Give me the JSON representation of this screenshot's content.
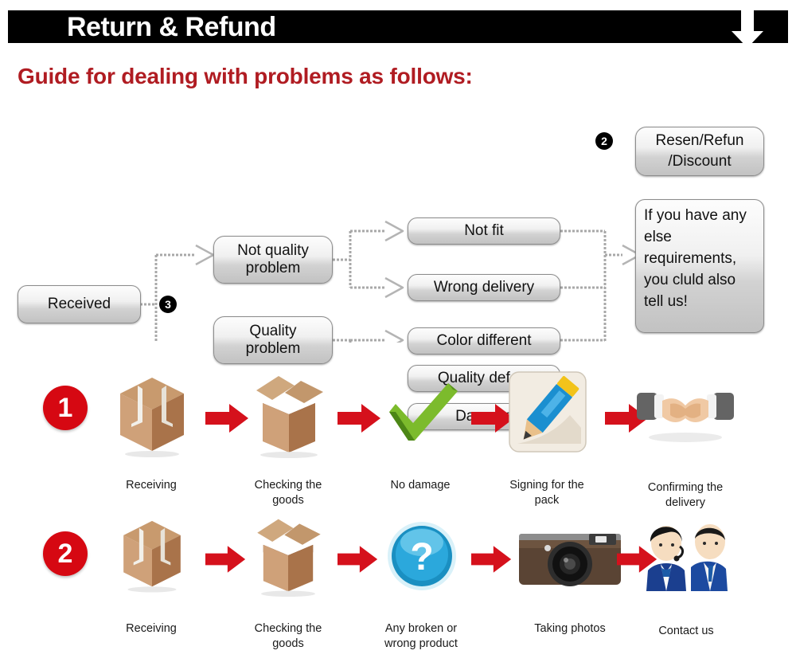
{
  "header": {
    "title": "Return & Refund",
    "arrow_icon": "down-arrow-icon",
    "subtitle": "Guide for dealing with problems as follows:"
  },
  "flowchart": {
    "marker_3": "3",
    "marker_2": "2",
    "nodes": {
      "received": "Received",
      "not_quality_problem": "Not quality\nproblem",
      "quality_problem": "Quality\nproblem",
      "not_fit": "Not fit",
      "wrong_delivery": "Wrong delivery",
      "color_different": "Color different",
      "quality_defect": "Quality defect",
      "damage": "Damage",
      "resend_refund": "Resen/Refun\n/Discount",
      "note": "If you have any else requirements, you cluld also tell us!"
    }
  },
  "process": {
    "rows": [
      {
        "badge": "1",
        "steps": [
          {
            "icon": "closed-box-icon",
            "label": "Receiving"
          },
          {
            "icon": "open-box-icon",
            "label": "Checking the goods"
          },
          {
            "icon": "green-check-icon",
            "label": "No damage"
          },
          {
            "icon": "pencil-sign-icon",
            "label": "Signing for the pack"
          },
          {
            "icon": "handshake-icon",
            "label": "Confirming the delivery"
          }
        ]
      },
      {
        "badge": "2",
        "steps": [
          {
            "icon": "closed-box-icon",
            "label": "Receiving"
          },
          {
            "icon": "open-box-icon",
            "label": "Checking the goods"
          },
          {
            "icon": "question-mark-icon",
            "label": "Any broken or wrong product"
          },
          {
            "icon": "camera-icon",
            "label": "Taking photos"
          },
          {
            "icon": "support-agents-icon",
            "label": "Contact us"
          }
        ]
      }
    ],
    "arrow_icon": "red-right-arrow-icon"
  },
  "colors": {
    "header_bar": "#000000",
    "subtitle": "#b01c22",
    "badge_red": "#d60812",
    "arrow_red": "#d5111c",
    "box_border": "#8c8c8c"
  }
}
